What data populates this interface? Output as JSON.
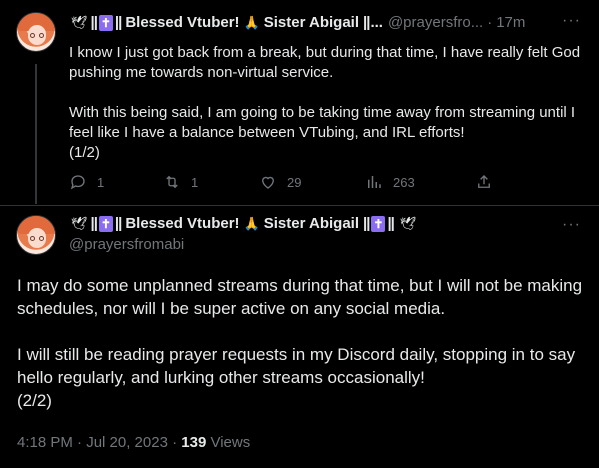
{
  "tweet1": {
    "display_name": "Blessed Vtuber!",
    "display_name_suffix": "Sister Abigail",
    "truncation": "...",
    "handle": "@prayersfro...",
    "separator": "·",
    "time_ago": "17m",
    "more_icon": "more-dots-icon",
    "paragraph1": "I know I just got back from a break, but during that time, I have really felt God pushing me towards non-virtual service.",
    "paragraph2": "With this being said, I am going to be taking time away from streaming until I feel like I have a balance between VTubing, and IRL efforts!",
    "paragraph3": "(1/2)",
    "actions": {
      "reply_count": "1",
      "repost_count": "1",
      "like_count": "29",
      "view_count": "263"
    }
  },
  "tweet2": {
    "display_name": "Blessed Vtuber!",
    "display_name_suffix": "Sister Abigail",
    "handle": "@prayersfromabi",
    "paragraph1": "I may do some unplanned streams during that time, but I will not be making schedules, nor will I be super active on any social media.",
    "paragraph2": "I will still be reading prayer requests in my Discord daily, stopping in to say hello regularly, and lurking other streams occasionally!",
    "paragraph3": "(2/2)",
    "time": "4:18 PM · Jul 20, 2023 ·",
    "views_count": "139",
    "views_label": "Views"
  },
  "colors": {
    "background": "#000000",
    "text": "#e7e9ea",
    "muted": "#71767b",
    "divider": "#2f3336",
    "cross_box": "#8a6df0"
  }
}
